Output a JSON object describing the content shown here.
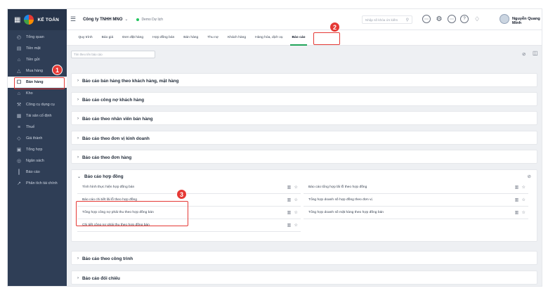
{
  "app": {
    "logo_text": "KẾ TOÁN"
  },
  "sidebar": {
    "items": [
      {
        "label": "Tổng quan",
        "icon": "gauge-icon"
      },
      {
        "label": "Tiền mặt",
        "icon": "cash-icon"
      },
      {
        "label": "Tiền gửi",
        "icon": "bank-icon"
      },
      {
        "label": "Mua hàng",
        "icon": "bag-icon"
      },
      {
        "label": "Bán hàng",
        "icon": "cart-icon"
      },
      {
        "label": "Kho",
        "icon": "warehouse-icon"
      },
      {
        "label": "Công cụ dụng cụ",
        "icon": "tools-icon"
      },
      {
        "label": "Tài sản cố định",
        "icon": "asset-icon"
      },
      {
        "label": "Thuế",
        "icon": "tax-icon"
      },
      {
        "label": "Giá thành",
        "icon": "tag-icon"
      },
      {
        "label": "Tổng hợp",
        "icon": "summary-icon"
      },
      {
        "label": "Ngân sách",
        "icon": "budget-icon"
      },
      {
        "label": "Báo cáo",
        "icon": "chart-icon"
      },
      {
        "label": "Phân tích tài chính",
        "icon": "analysis-icon"
      }
    ],
    "active": "Bán hàng"
  },
  "header": {
    "company": "Công ty TNHH MNO",
    "demo": "Demo Dự lịch",
    "search_placeholder": "Nhập số khóa ứn kiếm",
    "username": "Nguyễn Quang Minh"
  },
  "tabs": [
    "Quy trình",
    "Báo giá",
    "Đơn đặt hàng",
    "Hợp đồng bán",
    "Bán hàng",
    "Thu nợ",
    "Khách hàng",
    "Hàng hóa, dịch vụ",
    "Báo cáo"
  ],
  "active_tab": "Báo cáo",
  "filter_placeholder": "Tìm theo tên báo cáo",
  "steps": [
    "1",
    "2",
    "3"
  ],
  "groups": [
    {
      "title": "Báo cáo bán hàng theo khách hàng, mặt hàng",
      "expanded": false
    },
    {
      "title": "Báo cáo công nợ khách hàng",
      "expanded": false
    },
    {
      "title": "Báo cáo theo nhân viên bán hàng",
      "expanded": false
    },
    {
      "title": "Báo cáo theo đơn vị kinh doanh",
      "expanded": false
    },
    {
      "title": "Báo cáo theo đơn hàng",
      "expanded": false
    },
    {
      "title": "Báo cáo hợp đồng",
      "expanded": true
    },
    {
      "title": "Báo cáo theo công trình",
      "expanded": false
    },
    {
      "title": "Báo cáo đối chiếu",
      "expanded": false
    }
  ],
  "contract_reports": {
    "left": [
      "Tình hình thực hiện hợp đồng bán",
      "Báo cáo chi tiết lãi lỗ theo hợp đồng",
      "Tổng hợp công nợ phải thu theo hợp đồng bán",
      "Chi tiết công nợ phải thu theo hợp đồng bán"
    ],
    "right": [
      "Báo cáo tổng hợp lãi lỗ theo hợp đồng",
      "Tổng hợp doanh số hợp đồng theo đơn vị",
      "Tổng hợp doanh số mặt hàng theo hợp đồng bán"
    ]
  },
  "colors": {
    "sidebar_bg": "#2f3e56",
    "accent_green": "#22a55a",
    "annotation_red": "#e53935"
  }
}
